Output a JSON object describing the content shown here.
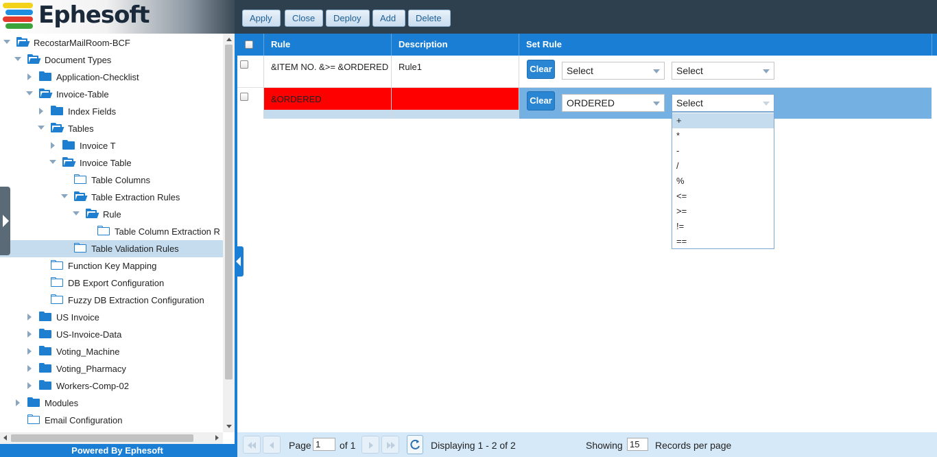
{
  "app": {
    "logo_text": "Ephesoft",
    "footer_text": "Powered By Ephesoft"
  },
  "toolbar": {
    "buttons": [
      "Apply",
      "Close",
      "Deploy",
      "Add",
      "Delete"
    ]
  },
  "tree": [
    {
      "label": "RecostarMailRoom-BCF",
      "level": 0,
      "toggle": "expanded",
      "folder": "open"
    },
    {
      "label": "Document Types",
      "level": 1,
      "toggle": "expanded",
      "folder": "open"
    },
    {
      "label": "Application-Checklist",
      "level": 2,
      "toggle": "collapsed",
      "folder": "closed"
    },
    {
      "label": "Invoice-Table",
      "level": 2,
      "toggle": "expanded",
      "folder": "open"
    },
    {
      "label": "Index Fields",
      "level": 3,
      "toggle": "collapsed",
      "folder": "closed"
    },
    {
      "label": "Tables",
      "level": 3,
      "toggle": "expanded",
      "folder": "open"
    },
    {
      "label": "Invoice T",
      "level": 4,
      "toggle": "collapsed",
      "folder": "closed"
    },
    {
      "label": "Invoice Table",
      "level": 4,
      "toggle": "expanded",
      "folder": "open"
    },
    {
      "label": "Table Columns",
      "level": 5,
      "toggle": "none",
      "folder": "empty"
    },
    {
      "label": "Table Extraction Rules",
      "level": 5,
      "toggle": "expanded",
      "folder": "open"
    },
    {
      "label": "Rule",
      "level": 6,
      "toggle": "expanded",
      "folder": "open"
    },
    {
      "label": "Table Column Extraction R",
      "level": 7,
      "toggle": "none",
      "folder": "empty"
    },
    {
      "label": "Table Validation Rules",
      "level": 5,
      "toggle": "none",
      "folder": "empty",
      "selected": true
    },
    {
      "label": "Function Key Mapping",
      "level": 3,
      "toggle": "none",
      "folder": "empty"
    },
    {
      "label": "DB Export Configuration",
      "level": 3,
      "toggle": "none",
      "folder": "empty"
    },
    {
      "label": "Fuzzy DB Extraction Configuration",
      "level": 3,
      "toggle": "none",
      "folder": "empty"
    },
    {
      "label": "US Invoice",
      "level": 2,
      "toggle": "collapsed",
      "folder": "closed"
    },
    {
      "label": "US-Invoice-Data",
      "level": 2,
      "toggle": "collapsed",
      "folder": "closed"
    },
    {
      "label": "Voting_Machine",
      "level": 2,
      "toggle": "collapsed",
      "folder": "closed"
    },
    {
      "label": "Voting_Pharmacy",
      "level": 2,
      "toggle": "collapsed",
      "folder": "closed"
    },
    {
      "label": "Workers-Comp-02",
      "level": 2,
      "toggle": "collapsed",
      "folder": "closed"
    },
    {
      "label": "Modules",
      "level": 1,
      "toggle": "collapsed",
      "folder": "closed"
    },
    {
      "label": "Email Configuration",
      "level": 1,
      "toggle": "none",
      "folder": "empty"
    }
  ],
  "grid": {
    "headers": {
      "rule": "Rule",
      "description": "Description",
      "set_rule": "Set Rule"
    },
    "clear_label": "Clear",
    "rows": [
      {
        "rule": "&ITEM NO. &>= &ORDERED",
        "description": "Rule1",
        "select1": "Select",
        "select2": "Select",
        "selected": false,
        "error": false
      },
      {
        "rule": "&ORDERED",
        "description": "",
        "select1": "ORDERED",
        "select2": "Select",
        "selected": true,
        "error": true
      }
    ],
    "dropdown_options": [
      "+",
      "*",
      "-",
      "/",
      "%",
      "<=",
      ">=",
      "!=",
      "=="
    ],
    "dropdown_highlighted": 0
  },
  "pager": {
    "page_label": "Page",
    "page_value": "1",
    "of_label": "of 1",
    "displaying": "Displaying 1 - 2 of 2",
    "showing_label": "Showing",
    "per_page_value": "15",
    "records_label": "Records per page"
  },
  "colors": {
    "accent": "#1a7fd4",
    "toolbar_bg": "#2e3f4e",
    "error_cell": "#ff0000",
    "selected_row": "#74b0e2"
  }
}
